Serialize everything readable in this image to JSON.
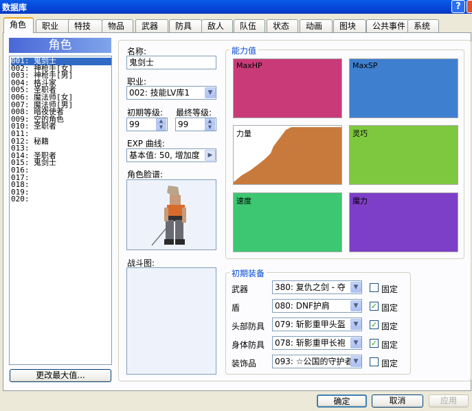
{
  "window": {
    "title": "数据库",
    "help": "?"
  },
  "tabs": [
    {
      "label": "角色",
      "active": true
    },
    {
      "label": "职业"
    },
    {
      "label": "特技"
    },
    {
      "label": "物品"
    },
    {
      "label": "武器"
    },
    {
      "label": "防具"
    },
    {
      "label": "敌人"
    },
    {
      "label": "队伍"
    },
    {
      "label": "状态"
    },
    {
      "label": "动画"
    },
    {
      "label": "图块"
    },
    {
      "label": "公共事件"
    },
    {
      "label": "系统"
    }
  ],
  "list": {
    "header": "角色",
    "items": [
      {
        "num": "001:",
        "name": "鬼剑士"
      },
      {
        "num": "002:",
        "name": "神枪手[女]"
      },
      {
        "num": "003:",
        "name": "神枪手[男]"
      },
      {
        "num": "004:",
        "name": "格斗家"
      },
      {
        "num": "005:",
        "name": "圣职者"
      },
      {
        "num": "006:",
        "name": "魔法师[女]"
      },
      {
        "num": "007:",
        "name": "魔法师[男]"
      },
      {
        "num": "008:",
        "name": "暗夜使者"
      },
      {
        "num": "009:",
        "name": "空的角色"
      },
      {
        "num": "010:",
        "name": "圣职者"
      },
      {
        "num": "011:",
        "name": ""
      },
      {
        "num": "012:",
        "name": "秘籍"
      },
      {
        "num": "013:",
        "name": ""
      },
      {
        "num": "014:",
        "name": "圣职者"
      },
      {
        "num": "015:",
        "name": "鬼剑士"
      },
      {
        "num": "016:",
        "name": ""
      },
      {
        "num": "017:",
        "name": ""
      },
      {
        "num": "018:",
        "name": ""
      },
      {
        "num": "019:",
        "name": ""
      },
      {
        "num": "020:",
        "name": ""
      }
    ],
    "max_button": "更改最大值..."
  },
  "form": {
    "name_label": "名称:",
    "name_value": "鬼剑士",
    "class_label": "职业:",
    "class_value": "002: 技能LV库1",
    "init_level_label": "初期等级:",
    "init_level_value": "99",
    "final_level_label": "最终等级:",
    "final_level_value": "99",
    "exp_label": "EXP 曲线:",
    "exp_value": "基本值: 50, 增加度",
    "portrait_label": "角色脸谱:",
    "battler_label": "战斗图:"
  },
  "stats": {
    "title": "能力值",
    "cells": [
      {
        "label": "MaxHP",
        "color": "#c93b78"
      },
      {
        "label": "MaxSP",
        "color": "#3f7fcf"
      },
      {
        "label": "力量",
        "color": "#c87a3c"
      },
      {
        "label": "灵巧",
        "color": "#7ec83f"
      },
      {
        "label": "速度",
        "color": "#3dc772"
      },
      {
        "label": "魔力",
        "color": "#7e3fc8"
      }
    ]
  },
  "equipment": {
    "title": "初期装备",
    "fixed_label": "固定",
    "rows": [
      {
        "label": "武器",
        "value": "380: 复仇之剑 - 夺",
        "fixed": false
      },
      {
        "label": "盾",
        "value": "080: DNF护肩",
        "fixed": true
      },
      {
        "label": "头部防具",
        "value": "079: 斩影重甲头盔",
        "fixed": true
      },
      {
        "label": "身体防具",
        "value": "078: 斩影重甲长袍",
        "fixed": true
      },
      {
        "label": "装饰品",
        "value": "093: ☆公国的守护者",
        "fixed": false
      }
    ]
  },
  "buttons": {
    "ok": "确定",
    "cancel": "取消",
    "apply": "应用"
  }
}
